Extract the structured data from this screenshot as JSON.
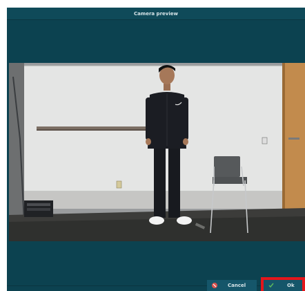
{
  "window": {
    "title": "Camera preview"
  },
  "footer": {
    "cancel_label": "Cancel",
    "ok_label": "Ok"
  },
  "icons": {
    "cancel": "cancel-circle-icon",
    "ok": "check-icon"
  },
  "colors": {
    "dialog_bg": "#0c4250",
    "button_bg": "#15566a",
    "highlight": "#e4161b",
    "cancel_icon": "#d9534f",
    "ok_icon": "#5cb85c"
  }
}
